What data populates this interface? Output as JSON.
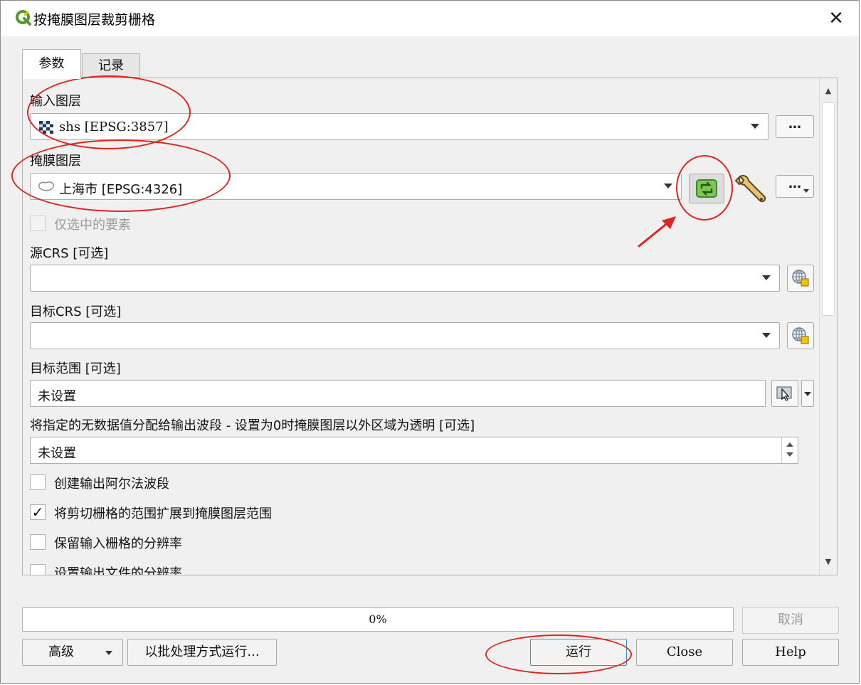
{
  "window": {
    "title": "按掩膜图层裁剪栅格",
    "close_glyph": "✕"
  },
  "tabs": [
    {
      "label": "参数",
      "active": true
    },
    {
      "label": "记录",
      "active": false
    }
  ],
  "params": {
    "input_layer": {
      "label": "输入图层",
      "value": "shs [EPSG:3857]"
    },
    "mask_layer": {
      "label": "掩膜图层",
      "value": "上海市 [EPSG:4326]"
    },
    "selected_only": {
      "label": "仅选中的要素",
      "checked": false,
      "enabled": false
    },
    "source_crs": {
      "label": "源CRS [可选]",
      "value": ""
    },
    "target_crs": {
      "label": "目标CRS [可选]",
      "value": ""
    },
    "target_extent": {
      "label": "目标范围 [可选]",
      "value": "未设置"
    },
    "nodata": {
      "label": "将指定的无数据值分配给输出波段 - 设置为0时掩膜图层以外区域为透明 [可选]",
      "value": "未设置"
    },
    "checkboxes": [
      {
        "label": "创建输出阿尔法波段",
        "checked": false
      },
      {
        "label": "将剪切栅格的范围扩展到掩膜图层范围",
        "checked": true
      },
      {
        "label": "保留输入栅格的分辨率",
        "checked": false
      },
      {
        "label": "设置输出文件的分辨率",
        "checked": false
      }
    ],
    "dots_label": "…",
    "check_glyph": "✓"
  },
  "progress": {
    "value": 0,
    "label": "0%"
  },
  "buttons": {
    "cancel": "取消",
    "advanced": "高级",
    "batch": "以批处理方式运行...",
    "run": "运行",
    "close": "Close",
    "help": "Help"
  },
  "colors": {
    "annotation": "#e0241f",
    "qgis_green": "#589632",
    "qgis_yellow": "#f0c400"
  }
}
